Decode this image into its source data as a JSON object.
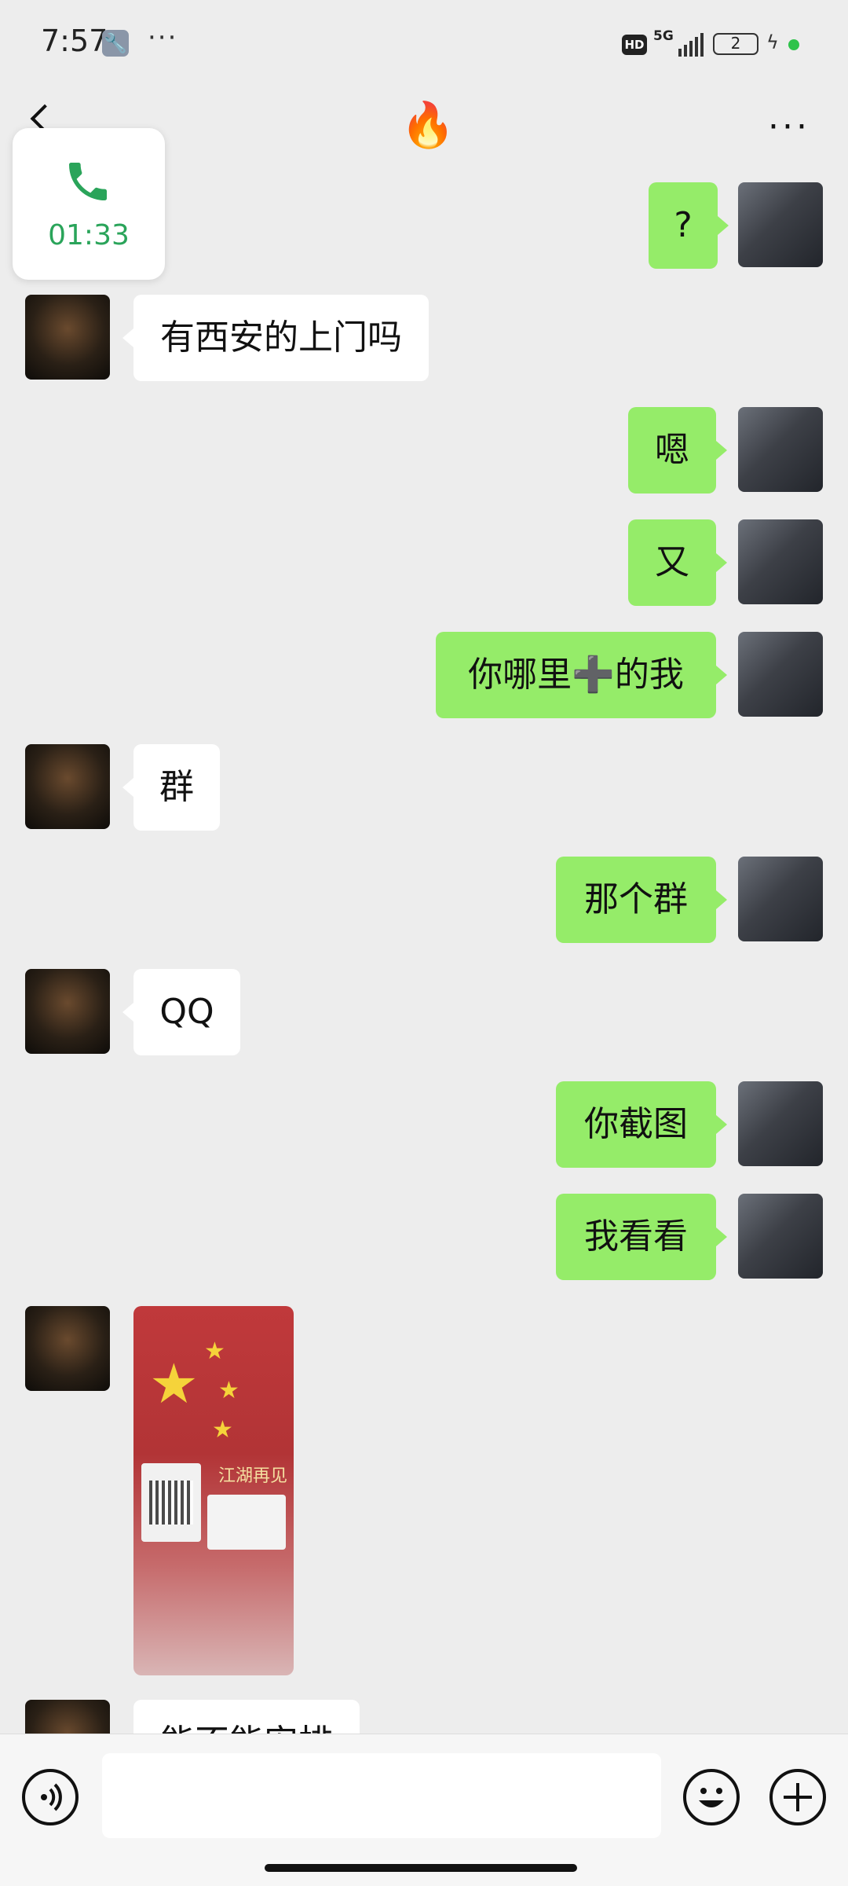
{
  "status": {
    "time": "7:57",
    "network": "5G",
    "hd": "HD",
    "battery": "2"
  },
  "header": {
    "title_icon": "fire-emoji"
  },
  "call": {
    "duration": "01:33"
  },
  "messages": [
    {
      "from": "me",
      "text": "?"
    },
    {
      "from": "other",
      "text": "有西安的上门吗"
    },
    {
      "from": "me",
      "text": "嗯"
    },
    {
      "from": "me",
      "text": "又"
    },
    {
      "from": "me",
      "text": "你哪里➕的我"
    },
    {
      "from": "other",
      "text": "群"
    },
    {
      "from": "me",
      "text": "那个群"
    },
    {
      "from": "other",
      "text": "QQ"
    },
    {
      "from": "me",
      "text": "你截图"
    },
    {
      "from": "me",
      "text": "我看看"
    },
    {
      "from": "other",
      "type": "image",
      "text": "江湖再见"
    },
    {
      "from": "other",
      "text": "能不能安排"
    }
  ],
  "colors": {
    "bg": "#ededed",
    "me_bubble": "#95ec69",
    "other_bubble": "#ffffff",
    "accent": "#2aa45a"
  },
  "icons": [
    "back-arrow-icon",
    "more-icon",
    "phone-icon",
    "voice-icon",
    "emoji-icon",
    "plus-icon"
  ]
}
